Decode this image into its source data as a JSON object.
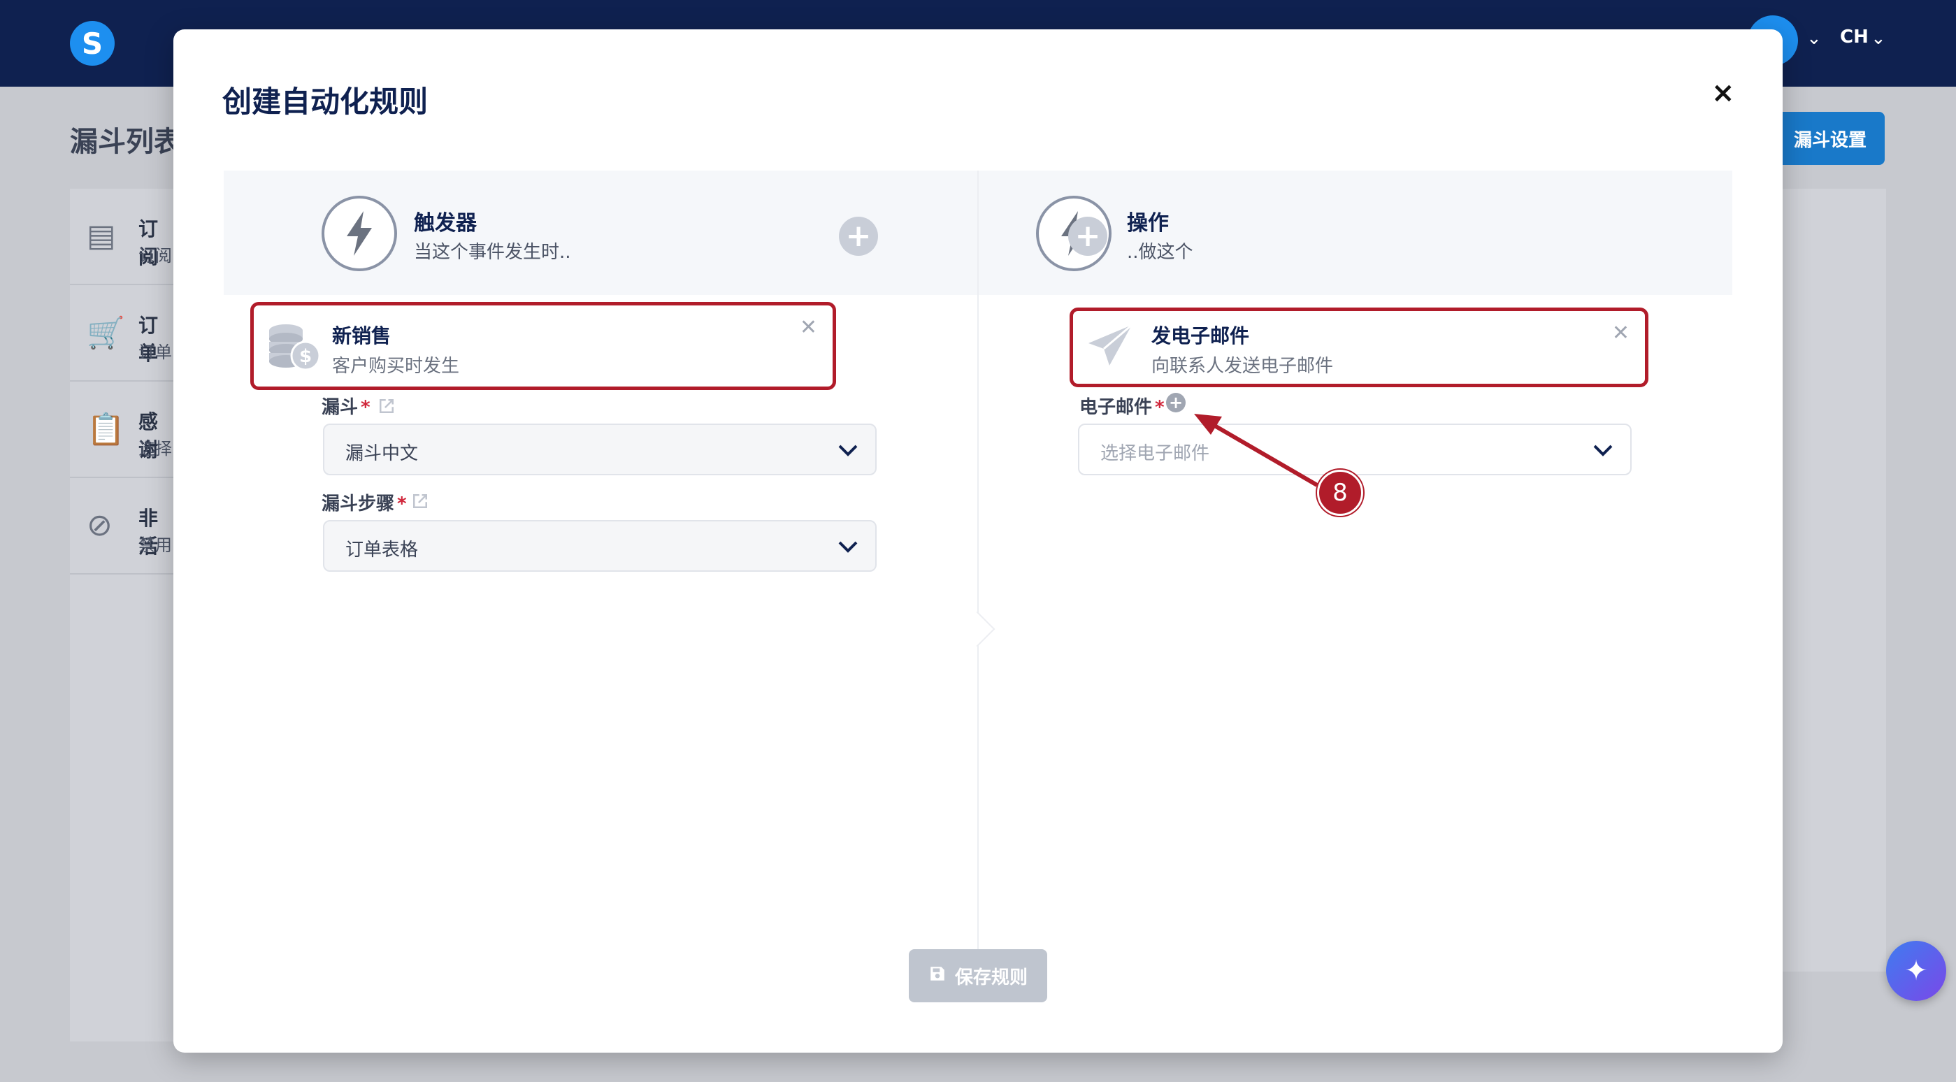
{
  "app": {
    "logo_letter": "S",
    "language": "CH",
    "page_title": "漏斗列表",
    "funnel_settings_button": "漏斗设置",
    "bg_list": [
      {
        "title": "订阅",
        "sub": "订阅",
        "icon": "newsletter-icon"
      },
      {
        "title": "订单",
        "sub": "订单",
        "icon": "cart-icon"
      },
      {
        "title": "感谢",
        "sub": "选择",
        "icon": "clipboard-check-icon"
      },
      {
        "title": "非活",
        "sub": "禁用",
        "icon": "ban-icon"
      }
    ]
  },
  "modal": {
    "title": "创建自动化规则",
    "close_label": "×",
    "trigger": {
      "title": "触发器",
      "subtitle": "当这个事件发生时..",
      "card": {
        "title": "新销售",
        "subtitle": "客户购买时发生"
      },
      "funnel_label": "漏斗",
      "funnel_value": "漏斗中文",
      "step_label": "漏斗步骤",
      "step_value": "订单表格"
    },
    "action": {
      "title": "操作",
      "subtitle": "..做这个",
      "card": {
        "title": "发电子邮件",
        "subtitle": "向联系人发送电子邮件"
      },
      "email_label": "电子邮件",
      "email_placeholder": "选择电子邮件"
    },
    "required_mark": "*",
    "save_button": "保存规则"
  },
  "annotation": {
    "badge_number": "8",
    "color": "#b11c2a"
  }
}
